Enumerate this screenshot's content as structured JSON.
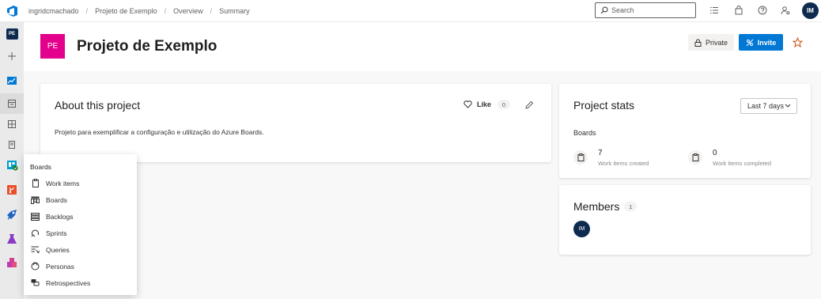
{
  "topbar": {
    "logo_icon": "azure-devops-logo",
    "breadcrumbs": [
      "ingridcmachado",
      "Projeto de Exemplo",
      "Overview",
      "Summary"
    ],
    "breadcrumb_separator": "/",
    "search_placeholder": "Search",
    "icons": [
      "list-icon",
      "shopping-bag-icon",
      "help-icon",
      "user-settings-icon"
    ],
    "user_initials": "IM"
  },
  "rail": {
    "project_initials": "PE",
    "items": [
      "add-icon",
      "overview-icon",
      "boards-icon",
      "dashboard-icon",
      "wiki-icon",
      "boards-hub-icon",
      "repos-icon",
      "pipelines-icon",
      "test-plans-icon",
      "artifacts-icon"
    ]
  },
  "project": {
    "initials": "PE",
    "name": "Projeto de Exemplo",
    "private_label": "Private",
    "invite_label": "Invite",
    "tile_color": "#e3008c"
  },
  "about": {
    "title": "About this project",
    "like_label": "Like",
    "like_count": "0",
    "description": "Projeto para exemplificar a configuração e utilização do Azure Boards."
  },
  "stats": {
    "title": "Project stats",
    "range": "Last 7 days",
    "section": "Boards",
    "created_value": "7",
    "created_label": "Work items created",
    "completed_value": "0",
    "completed_label": "Work items completed"
  },
  "members": {
    "title": "Members",
    "count": "1",
    "avatar": "IM"
  },
  "flyout": {
    "title": "Boards",
    "items": [
      {
        "label": "Work items",
        "icon": "work-items-icon"
      },
      {
        "label": "Boards",
        "icon": "boards-icon"
      },
      {
        "label": "Backlogs",
        "icon": "backlogs-icon"
      },
      {
        "label": "Sprints",
        "icon": "sprints-icon"
      },
      {
        "label": "Queries",
        "icon": "queries-icon"
      },
      {
        "label": "Personas",
        "icon": "personas-icon"
      },
      {
        "label": "Retrospectives",
        "icon": "retrospectives-icon"
      }
    ]
  },
  "colors": {
    "accent": "#0078d4",
    "avatar": "#0e2a4e",
    "project_tile": "#e3008c"
  }
}
